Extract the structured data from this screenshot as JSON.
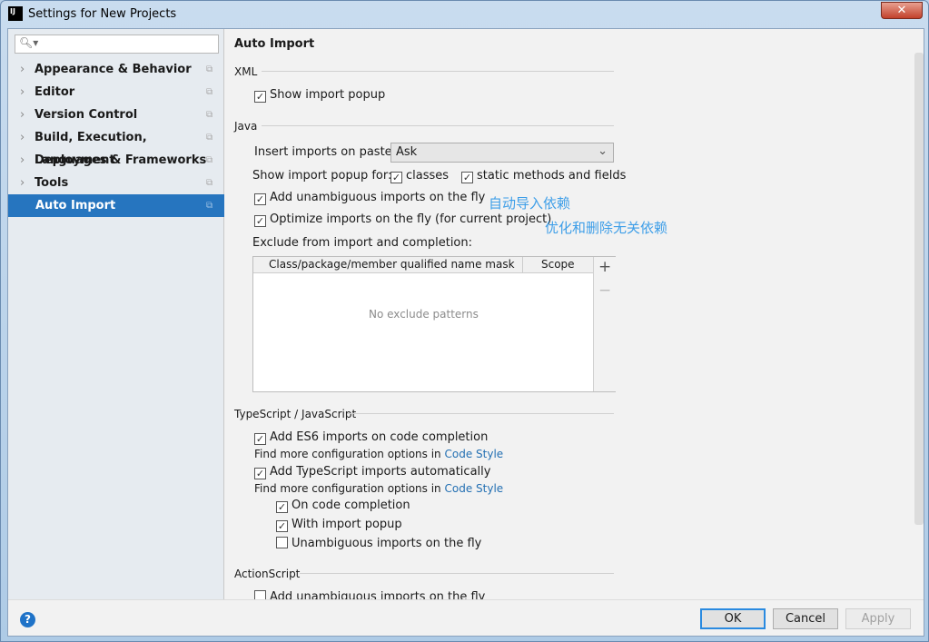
{
  "window": {
    "title": "Settings for New Projects",
    "close": "✕",
    "icon": "IJ"
  },
  "search": {
    "placeholder": "",
    "icon": "search-icon"
  },
  "sidebar": {
    "items": [
      {
        "label": "Appearance & Behavior"
      },
      {
        "label": "Editor"
      },
      {
        "label": "Version Control"
      },
      {
        "label": "Build, Execution, Deployment"
      },
      {
        "label": "Languages & Frameworks"
      },
      {
        "label": "Tools"
      },
      {
        "label": "Auto Import",
        "selected": true
      }
    ]
  },
  "main": {
    "title": "Auto Import",
    "xml": {
      "section": "XML",
      "show_popup": "Show import popup"
    },
    "java": {
      "section": "Java",
      "insert_label": "Insert imports on paste:",
      "insert_value": "Ask",
      "popup_for": "Show import popup for:",
      "classes": "classes",
      "static": "static methods and fields",
      "add_unambiguous": "Add unambiguous imports on the fly",
      "optimize": "Optimize imports on the fly (for current project)",
      "exclude": "Exclude from import and completion:",
      "col_mask": "Class/package/member qualified name mask",
      "col_scope": "Scope",
      "empty": "No exclude patterns",
      "add": "+",
      "remove": "−"
    },
    "notes": {
      "auto_import": "自动导入依赖",
      "optimize": "优化和删除无关依赖"
    },
    "ts": {
      "section": "TypeScript / JavaScript",
      "es6": "Add ES6 imports on code completion",
      "more1": "Find more configuration options in",
      "code_style": "Code Style",
      "ts_auto": "Add TypeScript imports automatically",
      "more2": "Find more configuration options in",
      "code_style2": "Code Style",
      "on_completion": "On code completion",
      "with_popup": "With import popup",
      "unambiguous": "Unambiguous imports on the fly"
    },
    "as": {
      "section": "ActionScript",
      "add_unambiguous": "Add unambiguous imports on the fly"
    }
  },
  "buttons": {
    "ok": "OK",
    "cancel": "Cancel",
    "apply": "Apply",
    "help": "?"
  },
  "colors": {
    "selection": "#2675bf",
    "link": "#2470b3",
    "note": "#3d9ee8"
  }
}
